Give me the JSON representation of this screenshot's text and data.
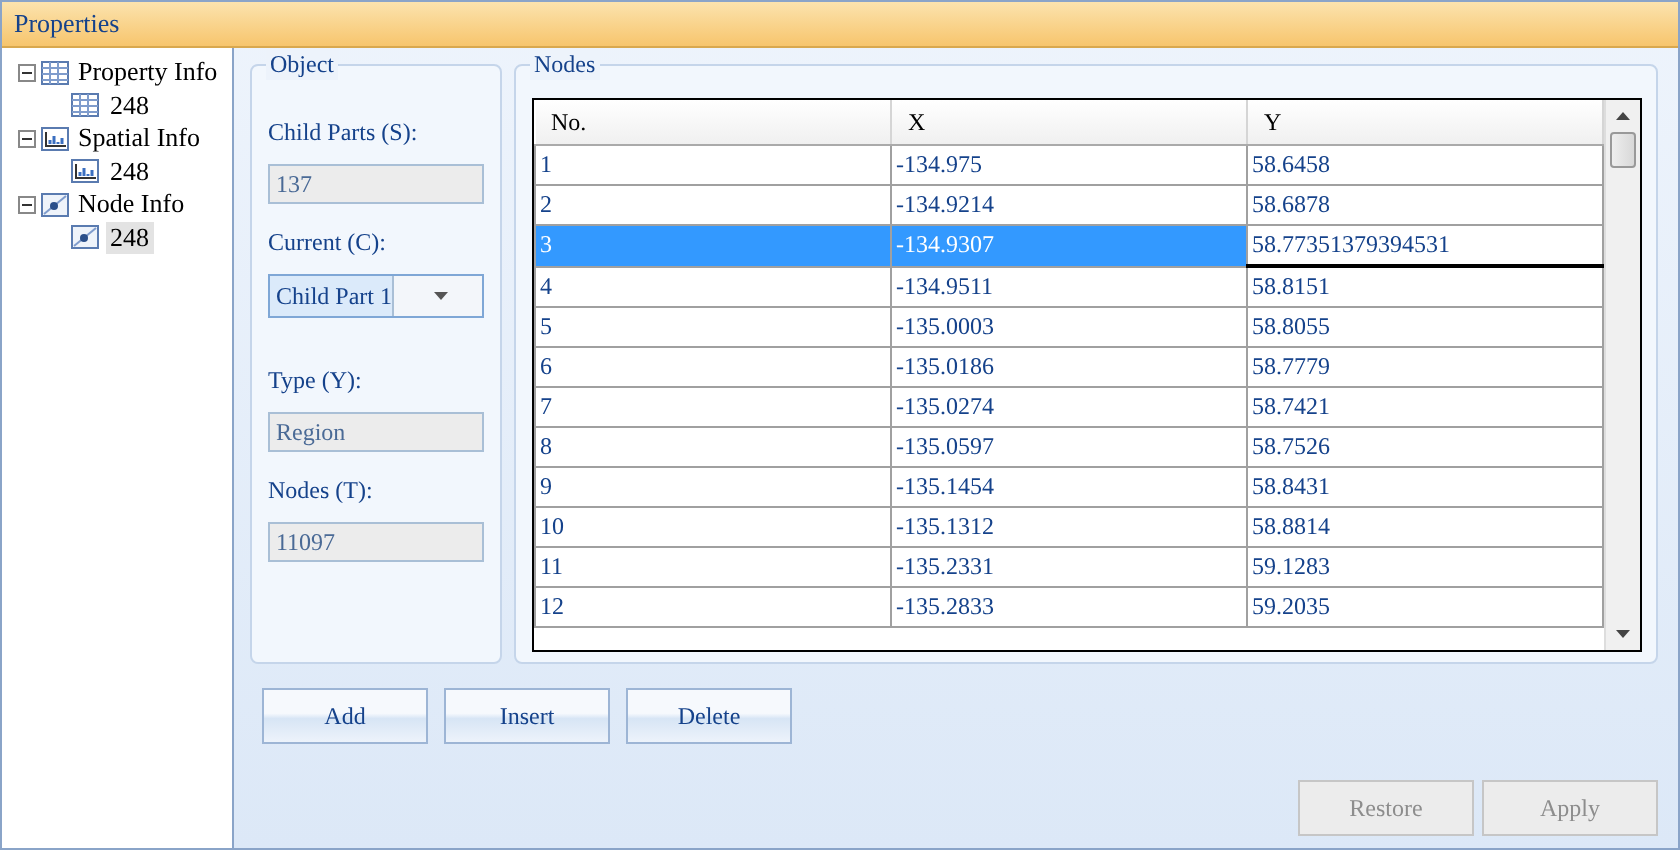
{
  "window": {
    "title": "Properties"
  },
  "tree": [
    {
      "label": "Property Info",
      "kind": "table",
      "expanded": true,
      "selected": false,
      "children": [
        {
          "label": "248",
          "kind": "table",
          "selected": false
        }
      ]
    },
    {
      "label": "Spatial Info",
      "kind": "chart",
      "expanded": true,
      "selected": false,
      "children": [
        {
          "label": "248",
          "kind": "chart",
          "selected": false
        }
      ]
    },
    {
      "label": "Node Info",
      "kind": "node",
      "expanded": true,
      "selected": false,
      "children": [
        {
          "label": "248",
          "kind": "node",
          "selected": true
        }
      ]
    }
  ],
  "object": {
    "title": "Object",
    "fields": [
      {
        "label": "Child Parts (S):",
        "value": "137",
        "kind": "readonly"
      },
      {
        "label": "Current (C):",
        "value": "Child Part 1",
        "kind": "dropdown"
      },
      {
        "label": "Type (Y):",
        "value": "Region",
        "kind": "readonly"
      },
      {
        "label": "Nodes (T):",
        "value": "11097",
        "kind": "readonly"
      }
    ]
  },
  "nodes": {
    "title": "Nodes",
    "columns": [
      "No.",
      "X",
      "Y"
    ],
    "rows": [
      {
        "cells": [
          "1",
          "-134.975",
          "58.6458"
        ],
        "selected": false,
        "editing": false
      },
      {
        "cells": [
          "2",
          "-134.9214",
          "58.6878"
        ],
        "selected": false,
        "editing": false
      },
      {
        "cells": [
          "3",
          "-134.9307",
          "58.77351379394531"
        ],
        "selected": true,
        "editing": true
      },
      {
        "cells": [
          "4",
          "-134.9511",
          "58.8151"
        ],
        "selected": false,
        "editing": false
      },
      {
        "cells": [
          "5",
          "-135.0003",
          "58.8055"
        ],
        "selected": false,
        "editing": false
      },
      {
        "cells": [
          "6",
          "-135.0186",
          "58.7779"
        ],
        "selected": false,
        "editing": false
      },
      {
        "cells": [
          "7",
          "-135.0274",
          "58.7421"
        ],
        "selected": false,
        "editing": false
      },
      {
        "cells": [
          "8",
          "-135.0597",
          "58.7526"
        ],
        "selected": false,
        "editing": false
      },
      {
        "cells": [
          "9",
          "-135.1454",
          "58.8431"
        ],
        "selected": false,
        "editing": false
      },
      {
        "cells": [
          "10",
          "-135.1312",
          "58.8814"
        ],
        "selected": false,
        "editing": false
      },
      {
        "cells": [
          "11",
          "-135.2331",
          "59.1283"
        ],
        "selected": false,
        "editing": false
      },
      {
        "cells": [
          "12",
          "-135.2833",
          "59.2035"
        ],
        "selected": false,
        "editing": false
      }
    ],
    "buttons": [
      "Add",
      "Insert",
      "Delete"
    ]
  },
  "footer_buttons": [
    {
      "label": "Restore",
      "disabled": true
    },
    {
      "label": "Apply",
      "disabled": true
    }
  ]
}
